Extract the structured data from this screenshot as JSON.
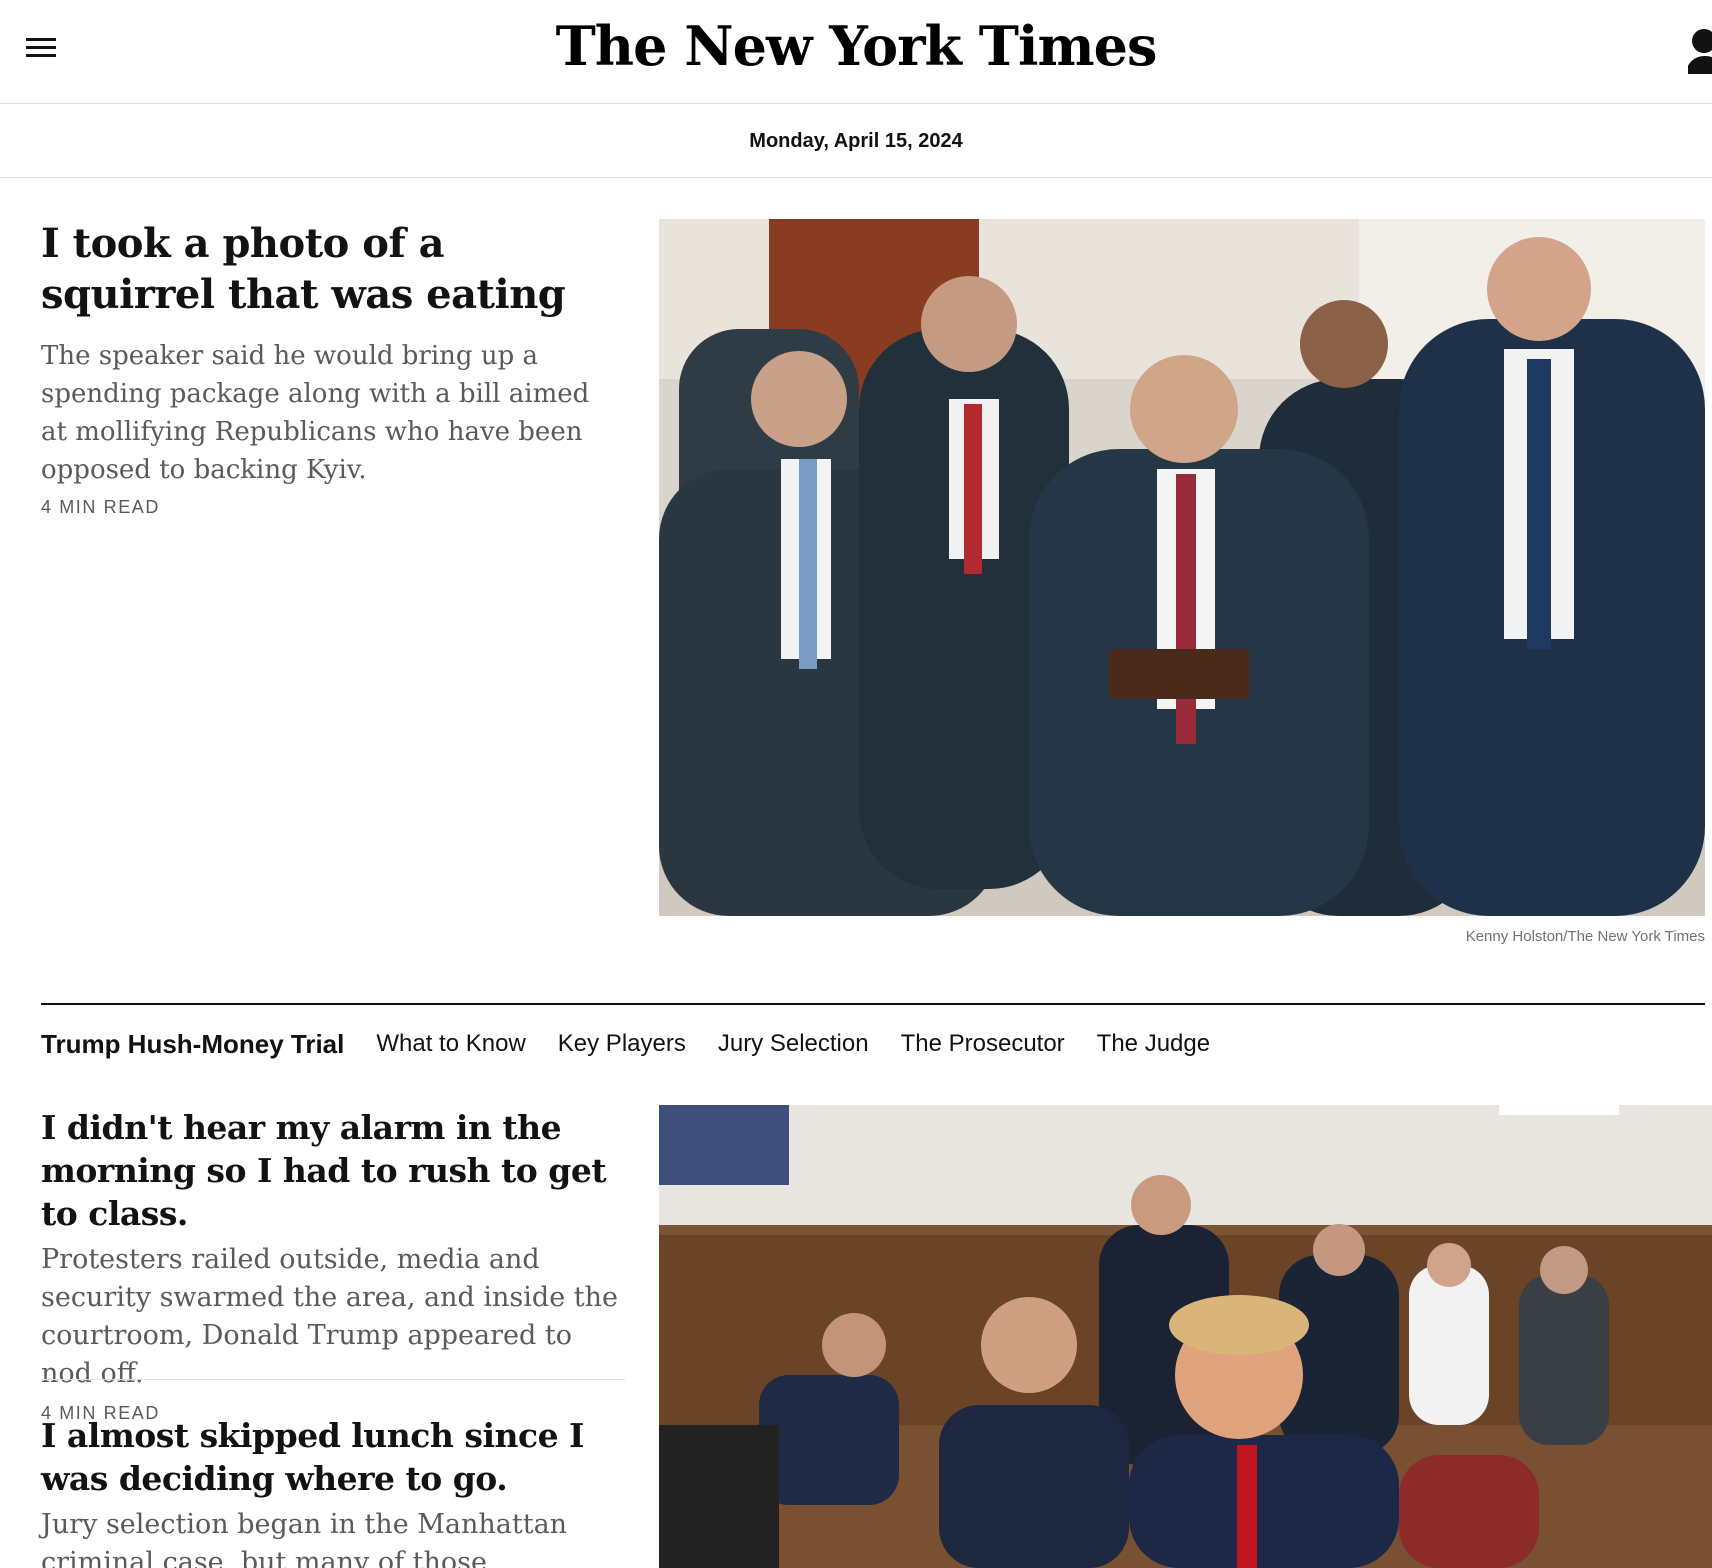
{
  "masthead": {
    "logo": "The New York Times",
    "menu_icon": "hamburger-menu-icon",
    "account_icon": "user-account-icon"
  },
  "dateline": "Monday, April 15, 2024",
  "lead_story": {
    "headline": "I took a photo of a squirrel that was eating",
    "summary": "The speaker said he would bring up a spending package along with a bill aimed at mollifying Republicans who have been opposed to backing Kyiv.",
    "read_time": "4 MIN READ",
    "photo_credit": "Kenny Holston/The New York Times"
  },
  "trial_section": {
    "label": "Trump Hush-Money Trial",
    "links": [
      "What to Know",
      "Key Players",
      "Jury Selection",
      "The Prosecutor",
      "The Judge"
    ]
  },
  "stories": [
    {
      "headline": "I didn't hear my alarm in the morning so I had to rush to get to class.",
      "summary": "Protesters railed outside, media and security swarmed the area, and inside the courtroom, Donald Trump appeared to nod off.",
      "read_time": "4 MIN READ"
    },
    {
      "headline": "I almost skipped lunch since I was deciding where to go.",
      "summary": "Jury selection began in the Manhattan criminal case, but many of those summoned"
    }
  ],
  "colors": {
    "text": "#121212",
    "summary": "#5a5a5a",
    "rule": "#dfdfdf"
  }
}
